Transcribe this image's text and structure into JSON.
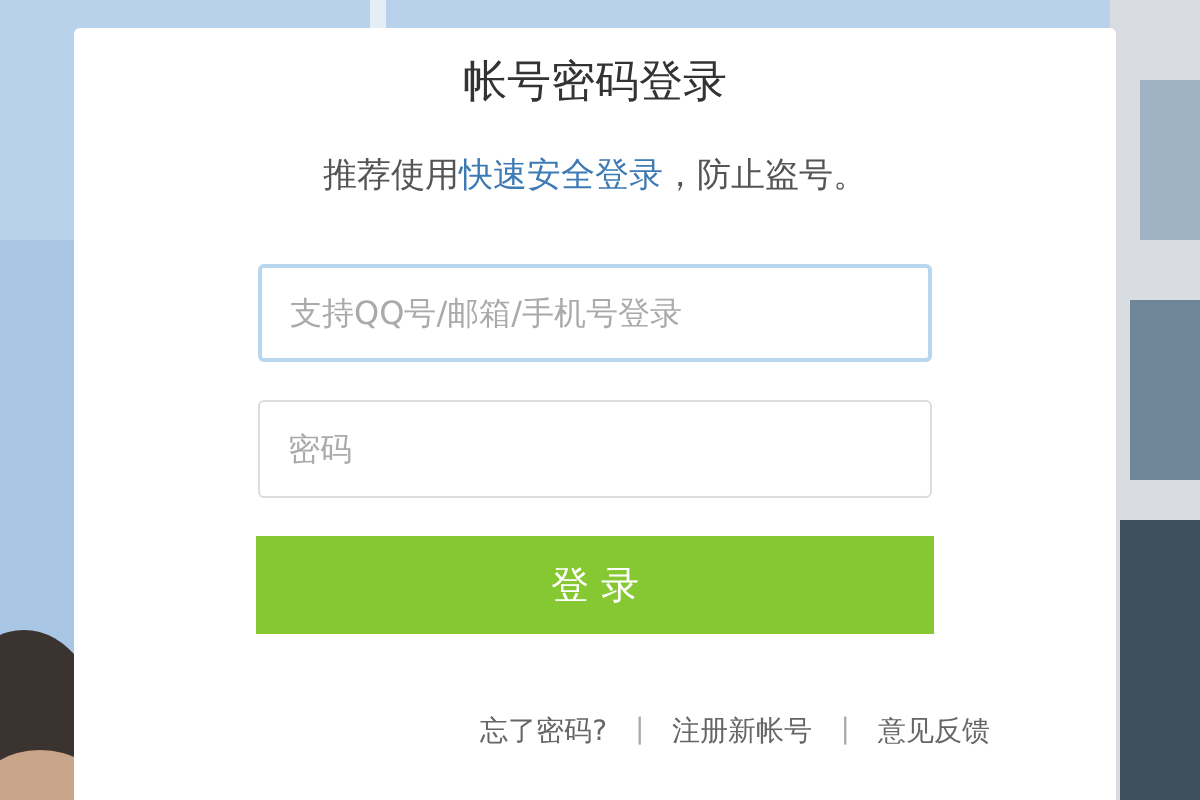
{
  "title": "帐号密码登录",
  "notice": {
    "before": "推荐使用",
    "link": "快速安全登录",
    "after": "，防止盗号。"
  },
  "fields": [
    {
      "placeholder": "支持QQ号/邮箱/手机号登录",
      "focused": true
    },
    {
      "placeholder": "密码",
      "focused": false
    }
  ],
  "submit": "登 录",
  "links": [
    {
      "label": "忘了密码?"
    },
    {
      "label": "注册新帐号"
    },
    {
      "label": "意见反馈"
    }
  ],
  "separator": "|"
}
